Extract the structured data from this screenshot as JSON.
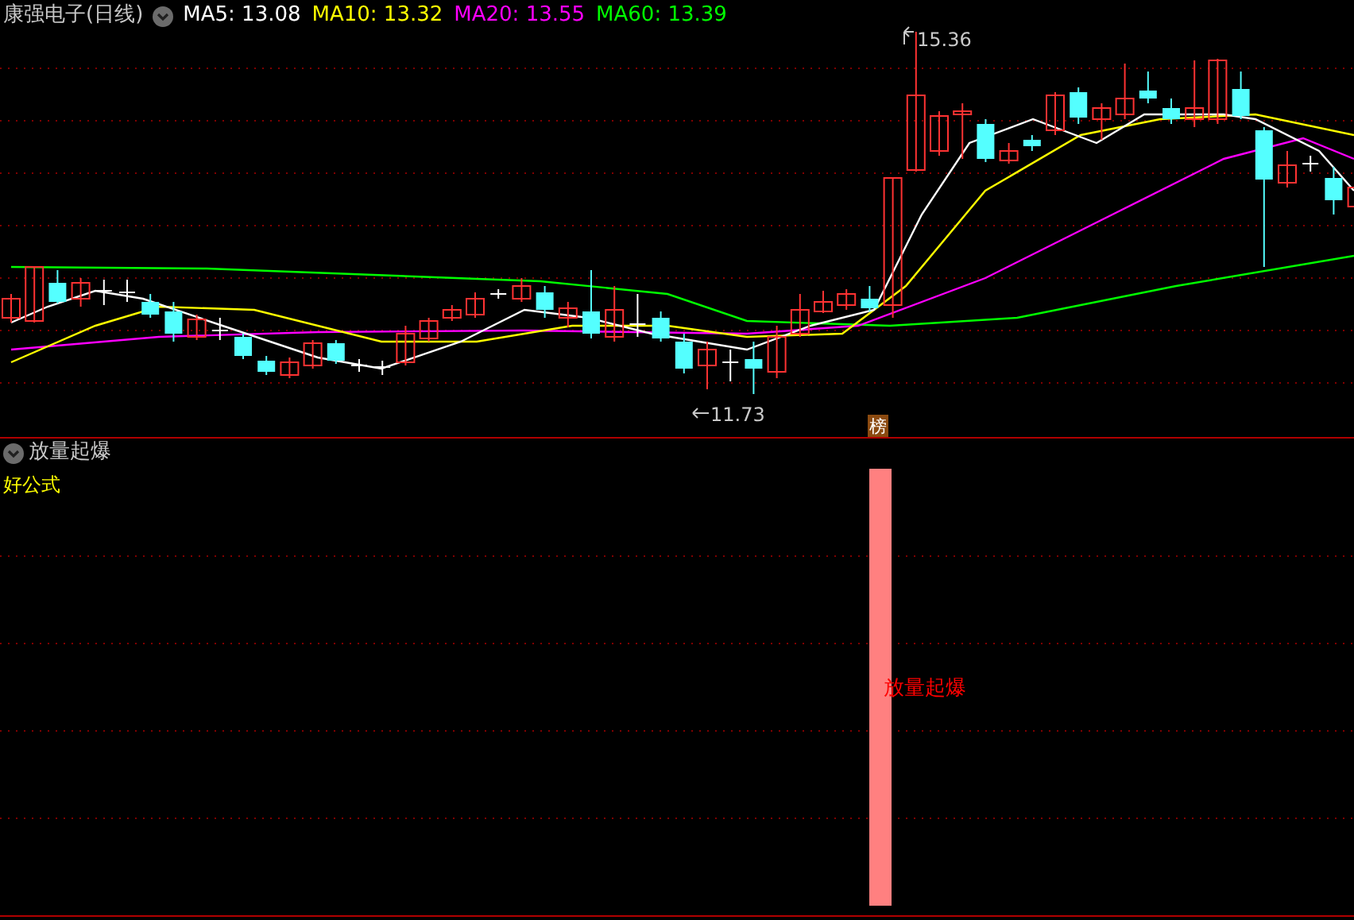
{
  "title": "康强电子(日线)",
  "indicators": [
    {
      "label": "MA5:",
      "value": "13.08",
      "color": "#ffffff"
    },
    {
      "label": "MA10:",
      "value": "13.32",
      "color": "#ffff00"
    },
    {
      "label": "MA20:",
      "value": "13.55",
      "color": "#ff00ff"
    },
    {
      "label": "MA60:",
      "value": "13.39",
      "color": "#00ff00"
    }
  ],
  "price_chart": {
    "high_label": "15.36",
    "low_label": "11.73",
    "badge": "榜"
  },
  "sub_panel": {
    "title": "放量起爆",
    "formula_label": "好公式",
    "signal_label": "放量起爆"
  }
}
